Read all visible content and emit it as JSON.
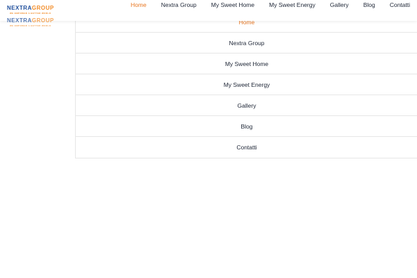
{
  "brand": {
    "name_part1": "NEXTRA",
    "name_part2": "GROUP",
    "tagline": "WE EMPOWER A BETTER WORLD"
  },
  "colors": {
    "accent_orange": "#e87722",
    "brand_blue": "#1f4e9c",
    "text_dark": "#222a3a",
    "divider": "#e6e6e6"
  },
  "top_nav": {
    "items": [
      {
        "label": "Home",
        "active": true
      },
      {
        "label": "Nextra Group",
        "active": false
      },
      {
        "label": "My Sweet Home",
        "active": false
      },
      {
        "label": "My Sweet Energy",
        "active": false
      },
      {
        "label": "Gallery",
        "active": false
      },
      {
        "label": "Blog",
        "active": false
      },
      {
        "label": "Contatti",
        "active": false
      }
    ]
  },
  "mobile_menu": {
    "items": [
      {
        "label": "Home",
        "active": true
      },
      {
        "label": "Nextra Group",
        "active": false
      },
      {
        "label": "My Sweet Home",
        "active": false
      },
      {
        "label": "My Sweet Energy",
        "active": false
      },
      {
        "label": "Gallery",
        "active": false
      },
      {
        "label": "Blog",
        "active": false
      },
      {
        "label": "Contatti",
        "active": false
      }
    ]
  }
}
